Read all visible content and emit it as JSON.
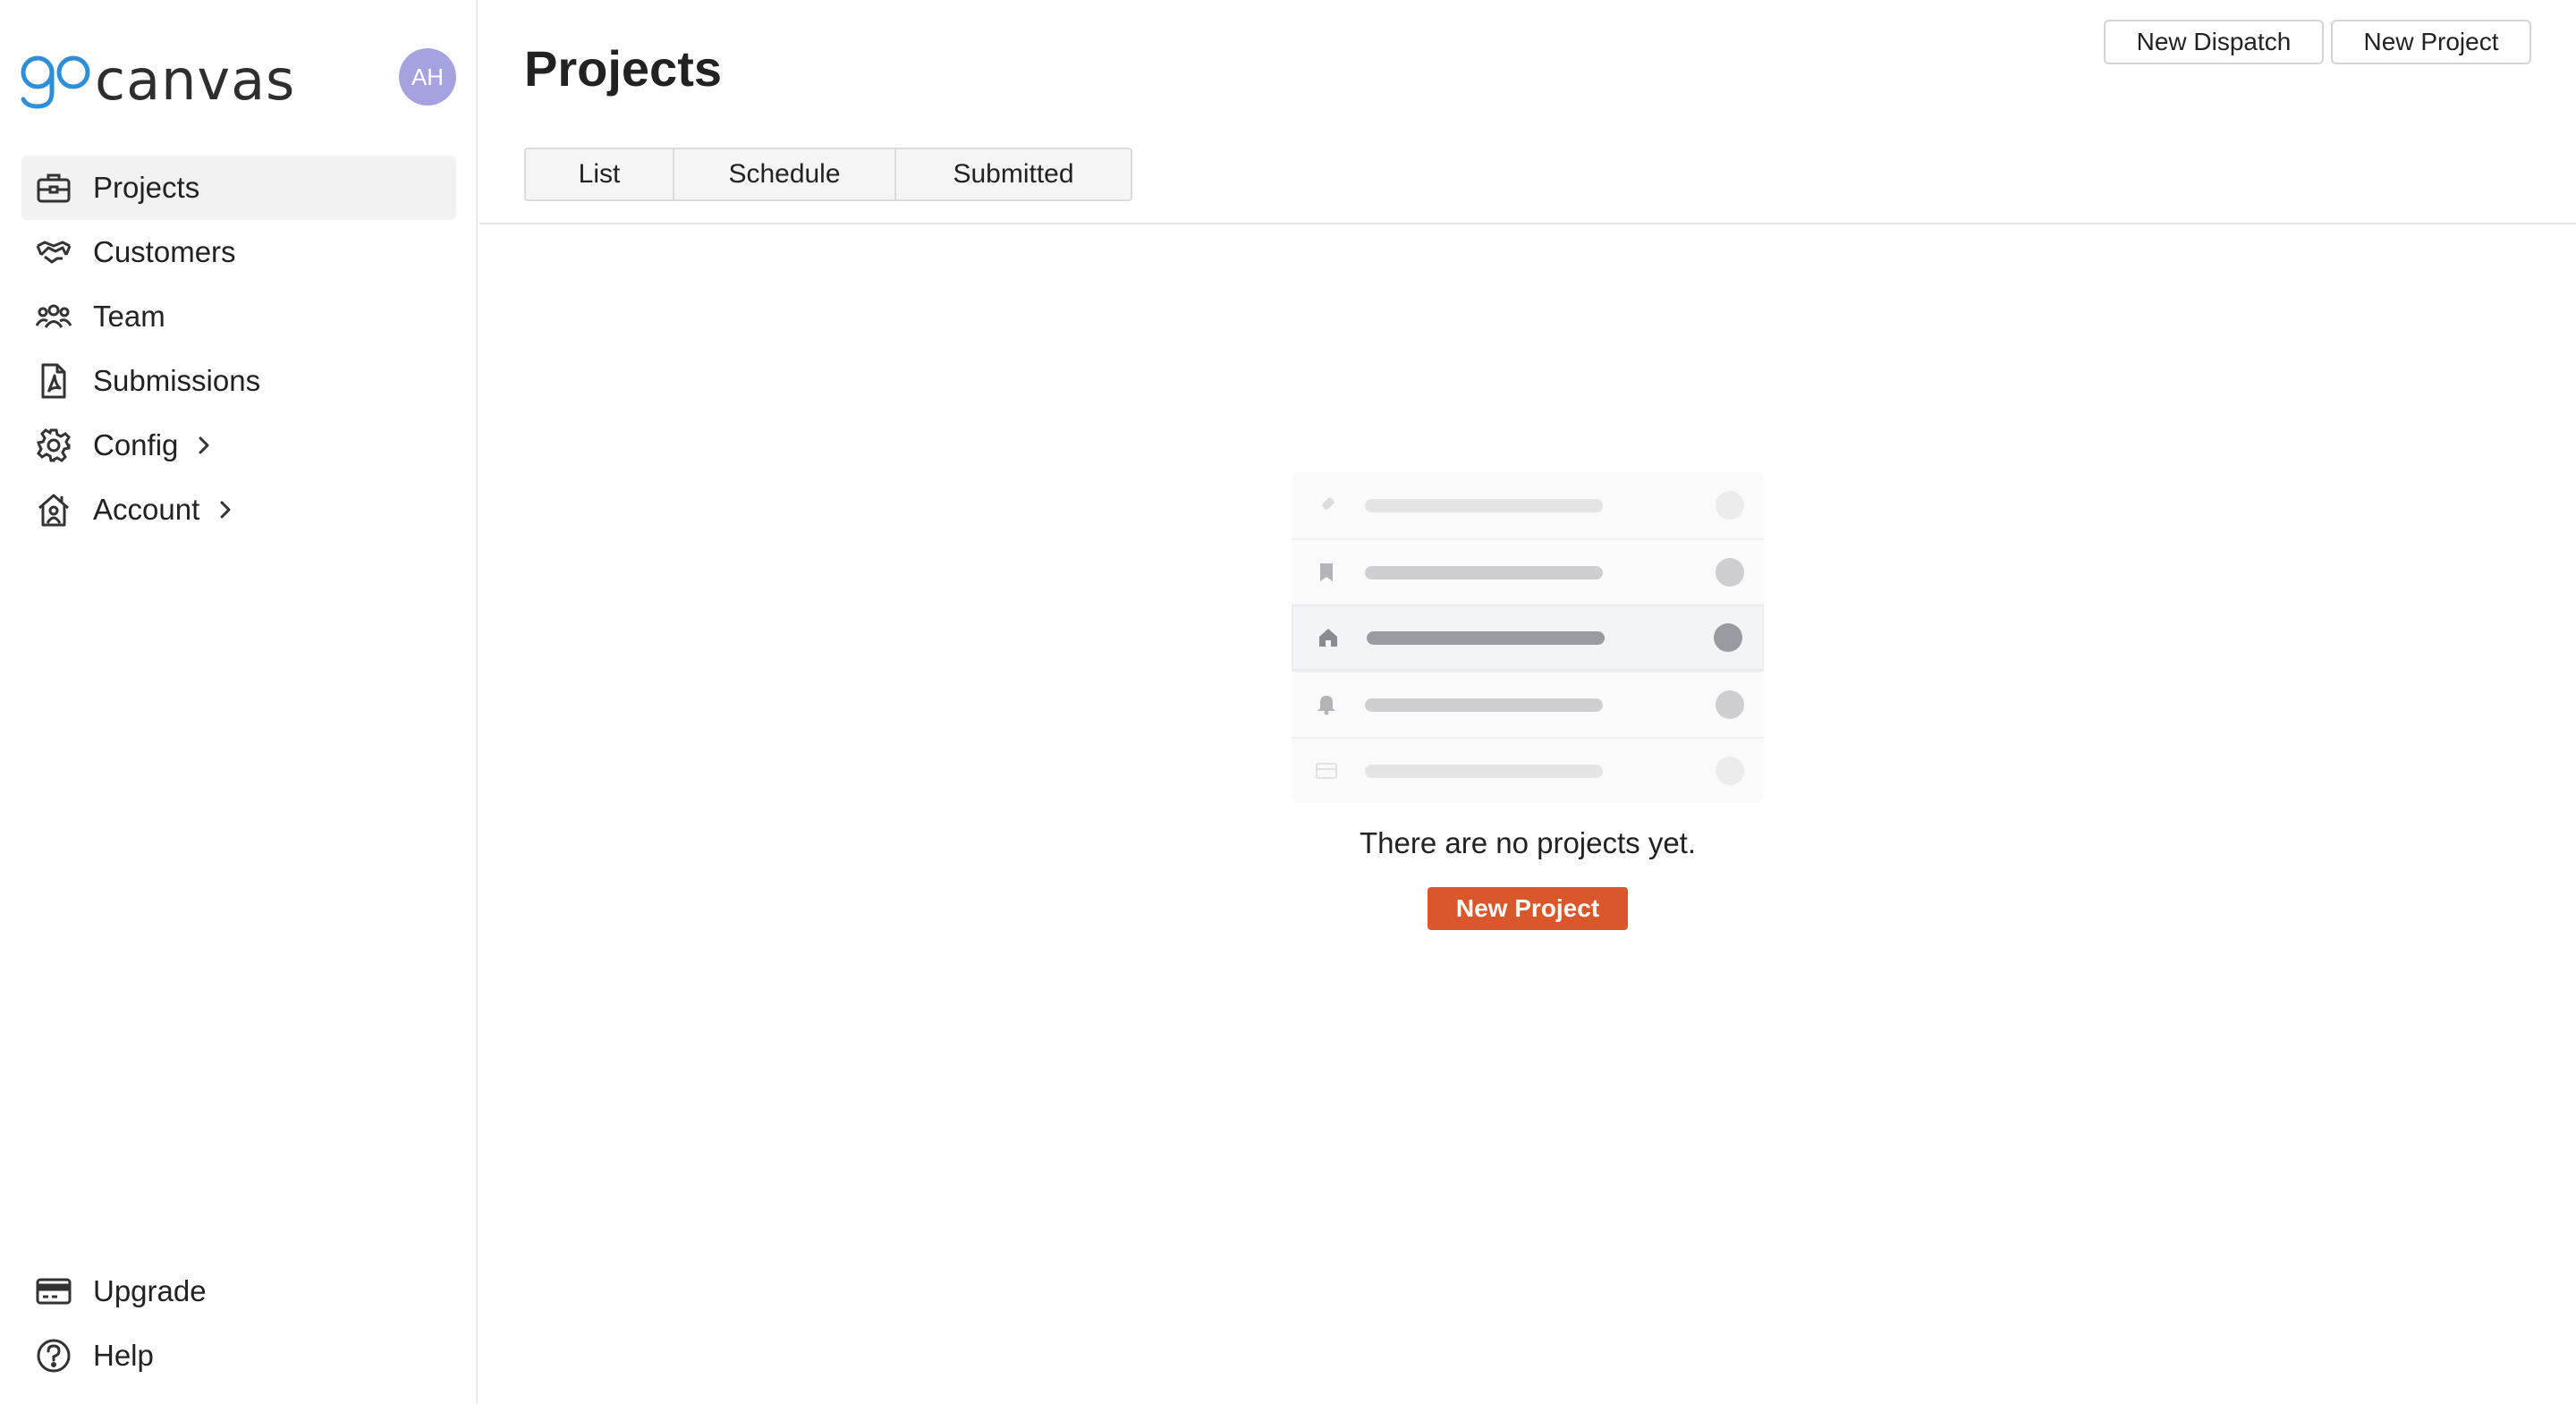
{
  "app": {
    "logo_go": "go",
    "logo_text": "canvas",
    "avatar_initials": "AH",
    "accent_color": "#d9572b",
    "avatar_color": "#a6a2e0",
    "logo_blue": "#2e8fd8"
  },
  "sidebar": {
    "items": [
      {
        "label": "Projects",
        "icon": "briefcase-icon",
        "active": true
      },
      {
        "label": "Customers",
        "icon": "handshake-icon"
      },
      {
        "label": "Team",
        "icon": "team-icon"
      },
      {
        "label": "Submissions",
        "icon": "pdf-document-icon"
      },
      {
        "label": "Config",
        "icon": "gear-icon",
        "has_submenu": true
      },
      {
        "label": "Account",
        "icon": "home-account-icon",
        "has_submenu": true
      }
    ],
    "bottom_items": [
      {
        "label": "Upgrade",
        "icon": "credit-card-icon"
      },
      {
        "label": "Help",
        "icon": "help-circle-icon"
      }
    ]
  },
  "header": {
    "title": "Projects",
    "new_dispatch_label": "New Dispatch",
    "new_project_label": "New Project"
  },
  "tabs": [
    {
      "label": "List"
    },
    {
      "label": "Schedule"
    },
    {
      "label": "Submitted"
    }
  ],
  "empty_state": {
    "message": "There are no projects yet.",
    "button_label": "New Project",
    "illustration_rows": [
      "rocket-icon",
      "bookmark-icon",
      "home-icon",
      "bell-icon",
      "card-icon"
    ]
  }
}
